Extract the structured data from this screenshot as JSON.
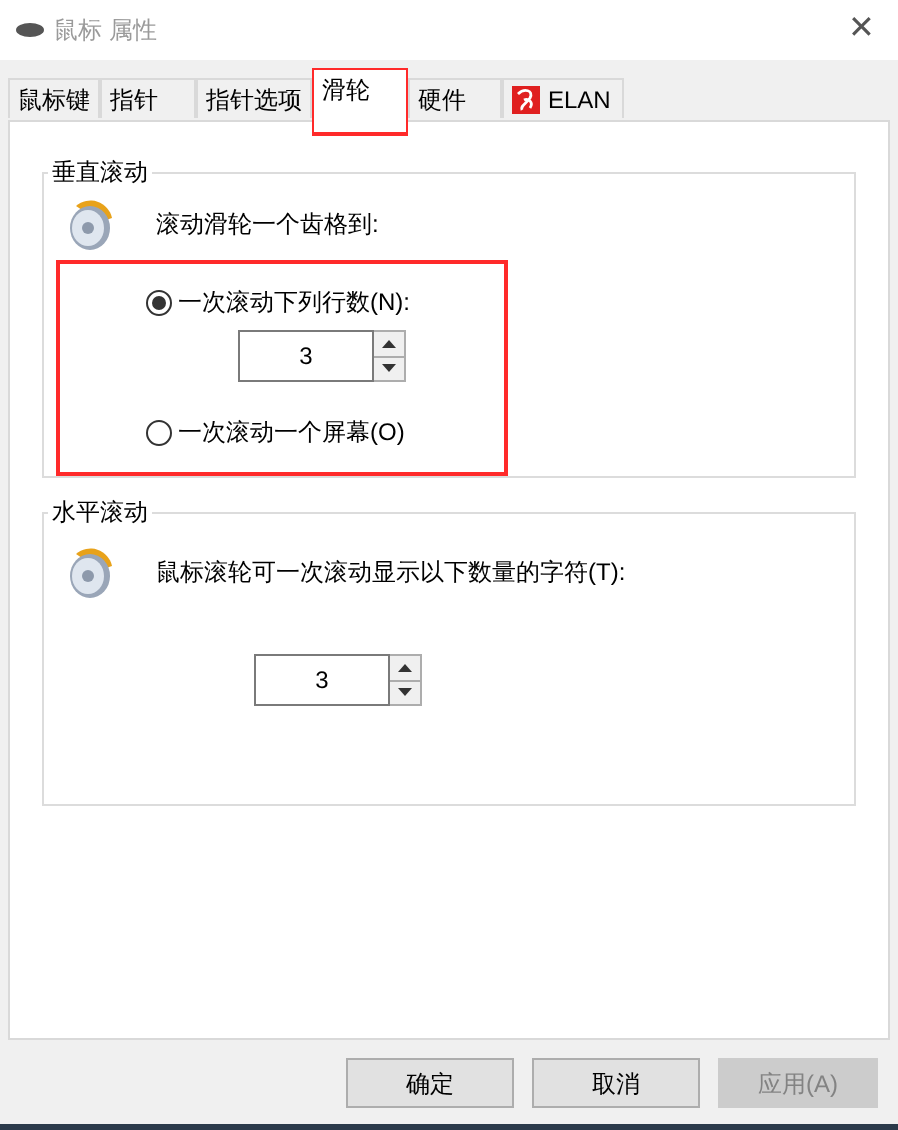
{
  "window": {
    "title": "鼠标 属性",
    "close": "✕"
  },
  "tabs": [
    {
      "label": "鼠标键",
      "selected": false,
      "highlighted": false,
      "kind": "text"
    },
    {
      "label": "指针",
      "selected": false,
      "highlighted": false,
      "kind": "text"
    },
    {
      "label": "指针选项",
      "selected": false,
      "highlighted": false,
      "kind": "text"
    },
    {
      "label": "滑轮",
      "selected": true,
      "highlighted": true,
      "kind": "text"
    },
    {
      "label": "硬件",
      "selected": false,
      "highlighted": false,
      "kind": "text"
    },
    {
      "label": "ELAN",
      "selected": false,
      "highlighted": false,
      "kind": "logo"
    }
  ],
  "vertical_scrolling": {
    "title": "垂直滚动",
    "prompt": "滚动滑轮一个齿格到:",
    "highlighted": true,
    "options": [
      {
        "label": "一次滚动下列行数(N):",
        "selected": true,
        "value": "3"
      },
      {
        "label": "一次滚动一个屏幕(O)",
        "selected": false
      }
    ]
  },
  "horizontal_scrolling": {
    "title": "水平滚动",
    "prompt": "鼠标滚轮可一次滚动显示以下数量的字符(T):",
    "value": "3"
  },
  "buttons": [
    {
      "label": "确定",
      "disabled": false
    },
    {
      "label": "取消",
      "disabled": false
    },
    {
      "label": "应用(A)",
      "disabled": true
    }
  ]
}
